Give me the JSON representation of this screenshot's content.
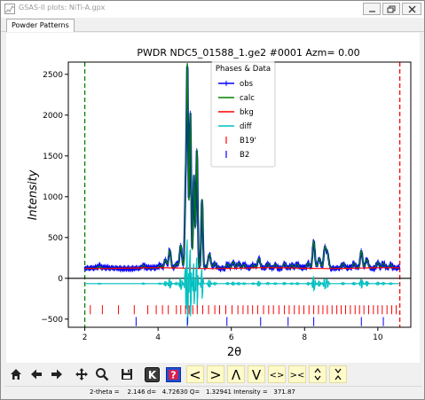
{
  "window": {
    "title": "GSAS-II plots: NiTi-A.gpx",
    "tab": "Powder Patterns"
  },
  "toolbar": {
    "icons": [
      "home-icon",
      "back-arrow-icon",
      "forward-arrow-icon",
      "pan-icon",
      "zoom-icon",
      "save-icon",
      "k-key-icon",
      "help-icon",
      "shift-left-icon",
      "shift-right-icon",
      "scale-up-icon",
      "scale-down-icon",
      "expand-x-icon",
      "contract-x-icon",
      "expand-y-icon",
      "contract-y-icon"
    ],
    "k_label": "K",
    "help_label": "?",
    "less_label": "<",
    "greater_label": ">",
    "up_label": "Λ",
    "down_label": "V",
    "expand_x_label": "<>",
    "contract_x_label": "><"
  },
  "status": {
    "text": "2-theta =    2.146 d=   4.72630 Q=   1.32941 Intensity =   371.87"
  },
  "colors": {
    "obs": "#0000ff",
    "calc": "#008000",
    "bkg": "#ff0000",
    "diff": "#00bfbf",
    "b19": "#ff0000",
    "b2": "#0000ff",
    "limit_low": "#008000",
    "limit_high": "#ff0000"
  },
  "chart_data": {
    "type": "line",
    "title": "PWDR NDC5_01588_1.ge2 #0001 Azm= 0.00",
    "xlabel": "2θ",
    "ylabel": "Intensity",
    "xlim": [
      1.55,
      10.9
    ],
    "ylim": [
      -600,
      2650
    ],
    "x_ticks": [
      2,
      4,
      6,
      8,
      10
    ],
    "x_tick_labels": [
      "2",
      "4",
      "6",
      "8",
      "10"
    ],
    "y_ticks": [
      -500,
      0,
      500,
      1000,
      1500,
      2000,
      2500
    ],
    "y_tick_labels": [
      "−500",
      "0",
      "500",
      "1000",
      "1500",
      "2000",
      "2500"
    ],
    "grid": false,
    "legend_title": "Phases & Data",
    "legend_position": "top-center",
    "legend": [
      "obs",
      "calc",
      "bkg",
      "diff",
      "B19'",
      "B2"
    ],
    "limits": {
      "low": 2.0,
      "high": 10.6
    },
    "zero_line": 0,
    "background_level": 125,
    "diff_offset": -65,
    "peaks": [
      {
        "x": 2.4,
        "h": 25
      },
      {
        "x": 3.6,
        "h": 35
      },
      {
        "x": 4.05,
        "h": 35
      },
      {
        "x": 4.2,
        "h": 100
      },
      {
        "x": 4.32,
        "h": 220
      },
      {
        "x": 4.5,
        "h": 60
      },
      {
        "x": 4.62,
        "h": 280
      },
      {
        "x": 4.75,
        "h": 900
      },
      {
        "x": 4.8,
        "h": 2450
      },
      {
        "x": 4.88,
        "h": 1900
      },
      {
        "x": 4.98,
        "h": 1150
      },
      {
        "x": 5.06,
        "h": 1450
      },
      {
        "x": 5.2,
        "h": 850
      },
      {
        "x": 5.4,
        "h": 170
      },
      {
        "x": 5.55,
        "h": 60
      },
      {
        "x": 5.9,
        "h": 50
      },
      {
        "x": 6.05,
        "h": 75
      },
      {
        "x": 6.2,
        "h": 60
      },
      {
        "x": 6.35,
        "h": 45
      },
      {
        "x": 6.6,
        "h": 40
      },
      {
        "x": 6.75,
        "h": 115
      },
      {
        "x": 7.0,
        "h": 55
      },
      {
        "x": 7.2,
        "h": 45
      },
      {
        "x": 7.45,
        "h": 55
      },
      {
        "x": 7.65,
        "h": 40
      },
      {
        "x": 7.8,
        "h": 50
      },
      {
        "x": 8.1,
        "h": 60
      },
      {
        "x": 8.25,
        "h": 330
      },
      {
        "x": 8.4,
        "h": 120
      },
      {
        "x": 8.55,
        "h": 230
      },
      {
        "x": 8.62,
        "h": 190
      },
      {
        "x": 9.05,
        "h": 55
      },
      {
        "x": 9.35,
        "h": 60
      },
      {
        "x": 9.55,
        "h": 210
      },
      {
        "x": 9.7,
        "h": 110
      },
      {
        "x": 10.0,
        "h": 70
      },
      {
        "x": 10.15,
        "h": 60
      },
      {
        "x": 10.35,
        "h": 45
      }
    ],
    "b19_ticks": [
      2.15,
      2.48,
      2.92,
      3.35,
      3.72,
      3.95,
      4.12,
      4.28,
      4.5,
      4.62,
      4.75,
      4.85,
      4.95,
      5.07,
      5.22,
      5.38,
      5.55,
      5.68,
      5.85,
      6.02,
      6.18,
      6.32,
      6.45,
      6.58,
      6.72,
      6.88,
      7.02,
      7.15,
      7.3,
      7.45,
      7.58,
      7.72,
      7.85,
      7.98,
      8.12,
      8.25,
      8.38,
      8.5,
      8.62,
      8.75,
      8.88,
      9.0,
      9.12,
      9.25,
      9.38,
      9.5,
      9.62,
      9.75,
      9.88,
      10.0,
      10.12,
      10.25,
      10.38,
      10.5
    ],
    "b2_ticks": [
      3.4,
      4.8,
      5.88,
      6.8,
      7.55,
      8.25,
      9.55,
      10.15
    ]
  }
}
